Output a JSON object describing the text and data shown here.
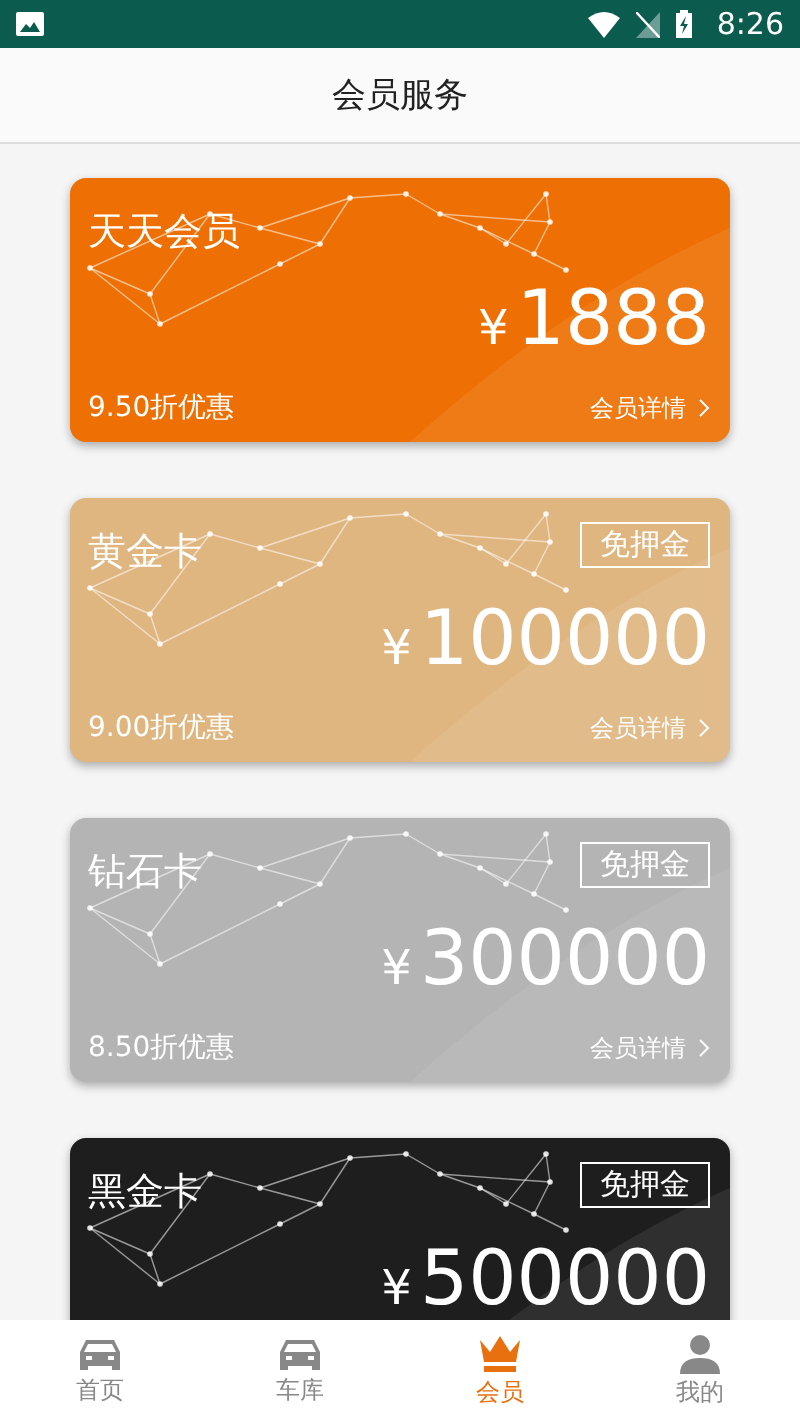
{
  "status_bar": {
    "time": "8:26"
  },
  "header": {
    "title": "会员服务"
  },
  "cards": [
    {
      "kind": "orange",
      "name": "天天会员",
      "currency": "¥",
      "price": "1888",
      "discount": "9.50折优惠",
      "details": "会员详情"
    },
    {
      "kind": "gold",
      "name": "黄金卡",
      "badge": "免押金",
      "currency": "¥",
      "price": "100000",
      "discount": "9.00折优惠",
      "details": "会员详情"
    },
    {
      "kind": "silver",
      "name": "钻石卡",
      "badge": "免押金",
      "currency": "¥",
      "price": "300000",
      "discount": "8.50折优惠",
      "details": "会员详情"
    },
    {
      "kind": "black",
      "name": "黑金卡",
      "badge": "免押金",
      "currency": "¥",
      "price": "500000"
    }
  ],
  "nav": [
    {
      "kind": "car",
      "label": "首页",
      "selected": false
    },
    {
      "kind": "car",
      "label": "车库",
      "selected": false
    },
    {
      "kind": "crown",
      "label": "会员",
      "selected": true
    },
    {
      "kind": "person",
      "label": "我的",
      "selected": false
    }
  ]
}
